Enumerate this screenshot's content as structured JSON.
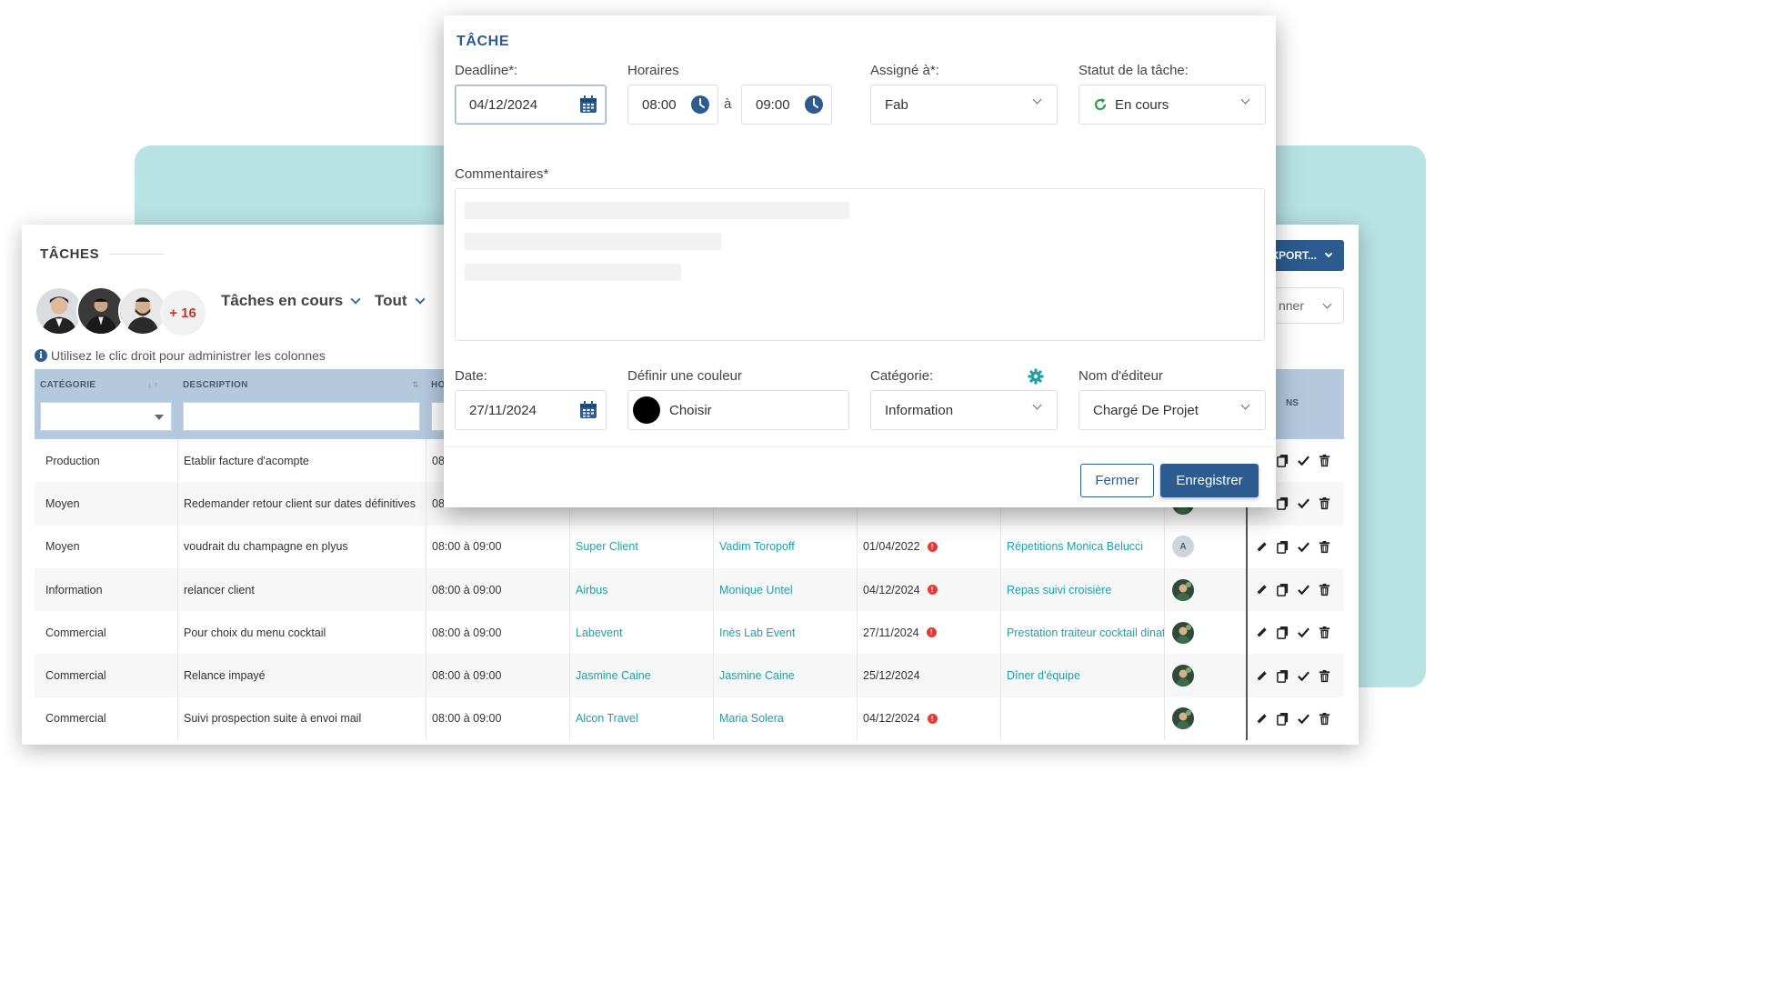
{
  "tasks_panel": {
    "title": "TÂCHES",
    "avatar_more": "+ 16",
    "filter_status": "Tâches en cours",
    "filter_scope": "Tout",
    "hint": "Utilisez le clic droit pour administrer les colonnes",
    "export_label": "XPORT...",
    "select_label": "nner",
    "columns": {
      "category": "CATÉGORIE",
      "description": "DESCRIPTION",
      "horaires": "HO",
      "actions": "NS"
    },
    "rows": [
      {
        "category": "Production",
        "description": "Etablir facture d'acompte",
        "horaires": "08",
        "client": "",
        "contact": "",
        "date": "",
        "late": false,
        "project": "",
        "avatar": ""
      },
      {
        "category": "Moyen",
        "description": "Redemander retour client sur dates définitives",
        "horaires": "08",
        "client": "",
        "contact": "",
        "date": "",
        "late": false,
        "project": "",
        "avatar": "photo"
      },
      {
        "category": "Moyen",
        "description": "voudrait du champagne en plyus",
        "horaires": "08:00 à 09:00",
        "client": "Super Client",
        "contact": "Vadim Toropoff",
        "date": "01/04/2022",
        "late": true,
        "project": "Répetitions Monica Belucci",
        "avatar": "A"
      },
      {
        "category": "Information",
        "description": "relancer client",
        "horaires": "08:00 à 09:00",
        "client": "Airbus",
        "contact": "Monique Untel",
        "date": "04/12/2024",
        "late": true,
        "project": "Repas suivi croisière",
        "avatar": "photo"
      },
      {
        "category": "Commercial",
        "description": "Pour choix du menu cocktail",
        "horaires": "08:00 à 09:00",
        "client": "Labevent",
        "contact": "Inès Lab Event",
        "date": "27/11/2024",
        "late": true,
        "project": "Prestation traiteur cocktail dinatoire",
        "avatar": "photo"
      },
      {
        "category": "Commercial",
        "description": "Relance impayé",
        "horaires": "08:00 à 09:00",
        "client": "Jasmine Caine",
        "contact": "Jasmine Caine",
        "date": "25/12/2024",
        "late": false,
        "project": "Dîner d'équipe",
        "avatar": "photo"
      },
      {
        "category": "Commercial",
        "description": "Suivi prospection suite à envoi mail",
        "horaires": "08:00 à 09:00",
        "client": "Alcon Travel",
        "contact": "Maria Solera",
        "date": "04/12/2024",
        "late": true,
        "project": "",
        "avatar": "photo"
      }
    ],
    "late_mark": "!"
  },
  "modal": {
    "title": "TÂCHE",
    "deadline_label": "Deadline*:",
    "deadline_value": "04/12/2024",
    "horaires_label": "Horaires",
    "time_from": "08:00",
    "time_sep": "à",
    "time_to": "09:00",
    "assigned_label": "Assigné à*:",
    "assigned_value": "Fab",
    "status_label": "Statut de la tâche:",
    "status_value": "En cours",
    "comments_label": "Commentaires*",
    "date_label": "Date:",
    "date_value": "27/11/2024",
    "color_label": "Définir une couleur",
    "color_value": "Choisir",
    "category_label": "Catégorie:",
    "category_value": "Information",
    "editor_label": "Nom d'éditeur",
    "editor_value": "Chargé De Projet",
    "close_label": "Fermer",
    "save_label": "Enregistrer"
  },
  "colors": {
    "accent": "#2b5b8f",
    "link": "#1f9fa8",
    "teal_bg": "#b8e3e3",
    "header": "#b4c8de",
    "late": "#e53935",
    "status_icon": "#2e9e4f"
  }
}
